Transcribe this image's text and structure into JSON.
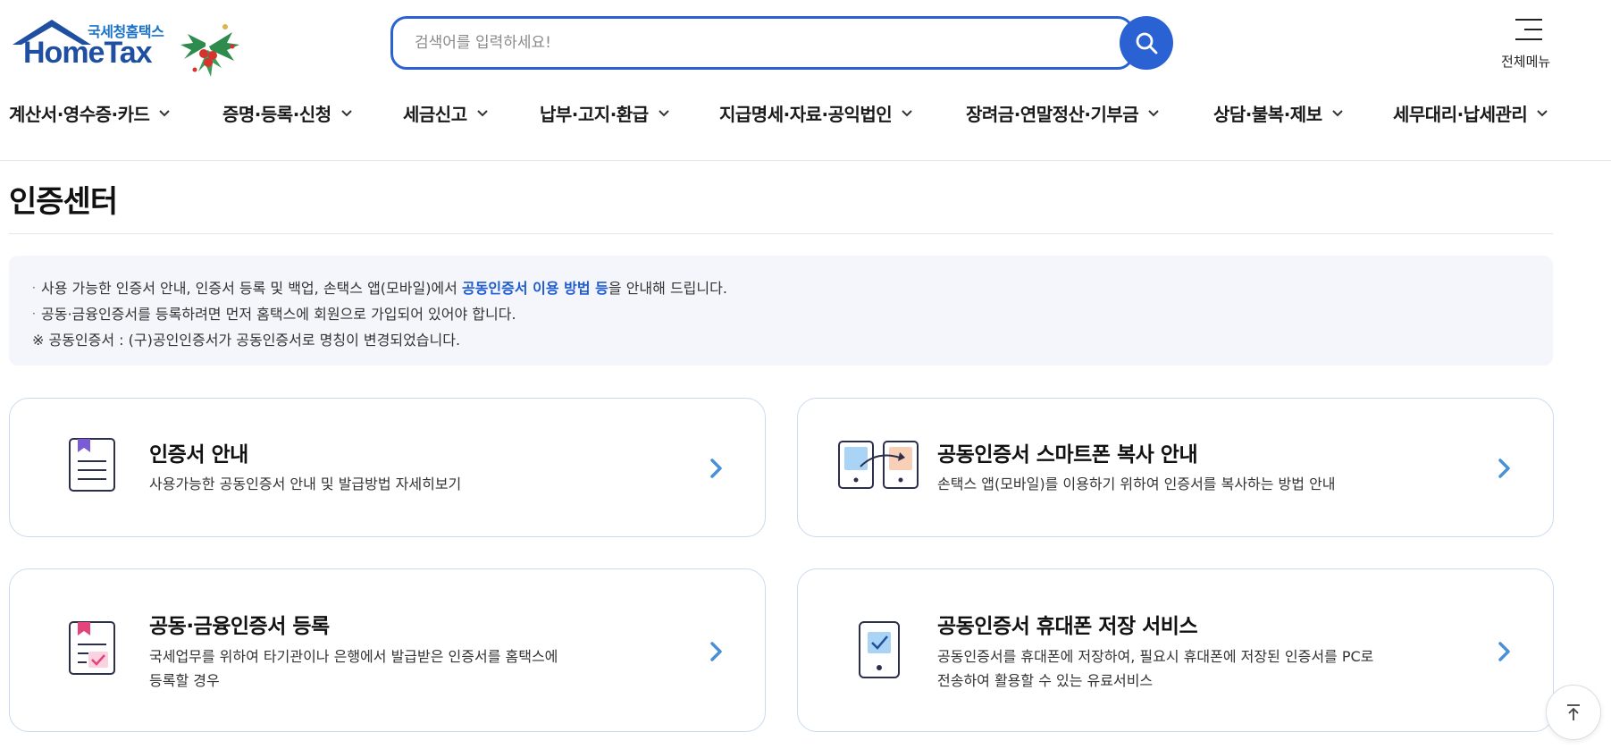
{
  "header": {
    "logo_sub": "국세청홈택스",
    "logo_main": "HomeTax",
    "search_placeholder": "검색어를 입력하세요!",
    "all_menu_label": "전체메뉴"
  },
  "nav": {
    "items": [
      {
        "label": "계산서·영수증·카드"
      },
      {
        "label": "증명·등록·신청"
      },
      {
        "label": "세금신고"
      },
      {
        "label": "납부·고지·환급"
      },
      {
        "label": "지급명세·자료·공익법인"
      },
      {
        "label": "장려금·연말정산·기부금"
      },
      {
        "label": "상담·불복·제보"
      },
      {
        "label": "세무대리·납세관리"
      }
    ]
  },
  "page": {
    "title": "인증센터"
  },
  "notice": {
    "line1_prefix": "사용 가능한 인증서 안내, 인증서 등록 및 백업, 손택스 앱(모바일)에서 ",
    "line1_highlight": "공동인증서 이용 방법 등",
    "line1_suffix": "을 안내해 드립니다.",
    "line2": "공동·금융인증서를 등록하려면 먼저 홈택스에 회원으로 가입되어 있어야 합니다.",
    "line3": "※ 공동인증서 : (구)공인인증서가 공동인증서로 명칭이 변경되었습니다."
  },
  "cards": [
    {
      "title": "인증서 안내",
      "desc": [
        "사용가능한 공동인증서 안내 및 발급방법 자세히보기"
      ],
      "icon": "certificate-doc-icon"
    },
    {
      "title": "공동인증서 스마트폰 복사 안내",
      "desc": [
        "손택스 앱(모바일)를 이용하기 위하여 인증서를 복사하는 방법 안내"
      ],
      "icon": "phone-copy-icon"
    },
    {
      "title": "공동·금융인증서 등록",
      "desc": [
        "국세업무를 위하여 타기관이나 은행에서 발급받은 인증서를 홈택스에",
        "등록할 경우"
      ],
      "icon": "certificate-register-icon"
    },
    {
      "title": "공동인증서 휴대폰 저장 서비스",
      "desc": [
        "공동인증서를 휴대폰에 저장하여, 필요시 휴대폰에 저장된 인증서를 PC로",
        "전송하여 활용할 수 있는 유료서비스"
      ],
      "icon": "phone-store-icon"
    }
  ],
  "colors": {
    "brand_blue": "#2a62d4",
    "link_blue": "#1f5bd1",
    "arrow_blue": "#4a90d9",
    "card_border": "#c9dbef",
    "notice_bg": "#f4f6fb"
  }
}
